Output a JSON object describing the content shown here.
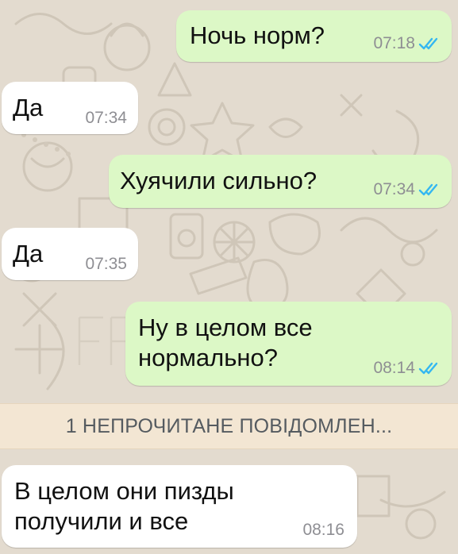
{
  "colors": {
    "outgoing_bubble": "#dcf8c6",
    "incoming_bubble": "#ffffff",
    "read_ticks": "#34b7f1",
    "chat_background": "#e3dbcf",
    "unread_bar": "#f3e6d3"
  },
  "messages": [
    {
      "direction": "outgoing",
      "text": "Ночь норм?",
      "time": "07:18",
      "status": "read"
    },
    {
      "direction": "incoming",
      "text": "Да",
      "time": "07:34"
    },
    {
      "direction": "outgoing",
      "text": "Хуячили сильно?",
      "time": "07:34",
      "status": "read"
    },
    {
      "direction": "incoming",
      "text": "Да",
      "time": "07:35"
    },
    {
      "direction": "outgoing",
      "text": "Ну в целом все\nнормально?",
      "time": "08:14",
      "status": "read"
    },
    {
      "direction": "incoming",
      "text": "В целом они пизды\nполучили и все",
      "time": "08:16"
    }
  ],
  "unread_banner": "1 НЕПРОЧИТАНЕ ПОВІДОМЛЕН..."
}
